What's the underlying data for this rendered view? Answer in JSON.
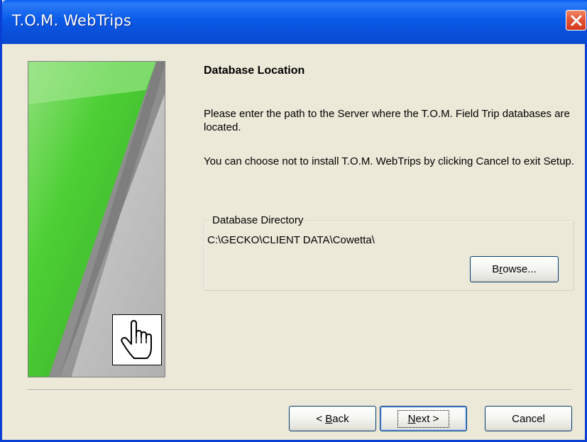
{
  "window": {
    "title": "T.O.M. WebTrips"
  },
  "page": {
    "heading": "Database Location",
    "paragraph1": "Please enter the path to the Server where the T.O.M. Field Trip databases are located.",
    "paragraph2": "You can choose not to install T.O.M. WebTrips by clicking Cancel to exit Setup."
  },
  "directory_group": {
    "legend": "Database Directory",
    "path": "C:\\GECKO\\CLIENT DATA\\Cowetta\\",
    "browse": {
      "pre": "B",
      "accel": "r",
      "post": "owse..."
    }
  },
  "buttons": {
    "back": {
      "pre": "< ",
      "accel": "B",
      "post": "ack"
    },
    "next": {
      "pre": "",
      "accel": "N",
      "post": "ext >"
    },
    "cancel": "Cancel"
  },
  "colors": {
    "titlebar": "#0a5ae8",
    "close": "#d2391c",
    "panel_green": "#4fc93a",
    "dialog_bg": "#ece9d8"
  },
  "icons": {
    "close": "close-icon",
    "hand": "hand-pointer-icon"
  }
}
